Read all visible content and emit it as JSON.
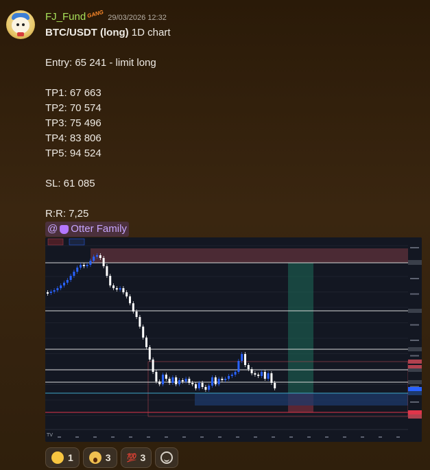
{
  "message": {
    "username": "FJ_Fund",
    "user_tag": "GANG",
    "timestamp": "29/03/2026 12:32",
    "title_bold": "BTC/USDT (long)",
    "title_rest": " 1D chart",
    "entry": "Entry: 65 241 - limit long",
    "tps": [
      "TP1: 67 663",
      "TP2: 70 574",
      "TP3: 75 496",
      "TP4: 83 806",
      "TP5: 94 524"
    ],
    "sl": "SL: 61 085",
    "rr": "R:R: 7,25",
    "mention": "@",
    "mention_label": "Otter Family"
  },
  "reactions": [
    {
      "icon": "salute-face-icon",
      "count": "1"
    },
    {
      "icon": "screaming-face-icon",
      "count": "3"
    },
    {
      "icon": "hundred-points-icon",
      "emoji": "💯",
      "count": "3"
    }
  ],
  "colors": {
    "username": "#a8e05a",
    "mention": "#c7a6ff",
    "candle_up": "#2962ff",
    "candle_down": "#ffffff",
    "chart_bg": "#131722"
  }
}
